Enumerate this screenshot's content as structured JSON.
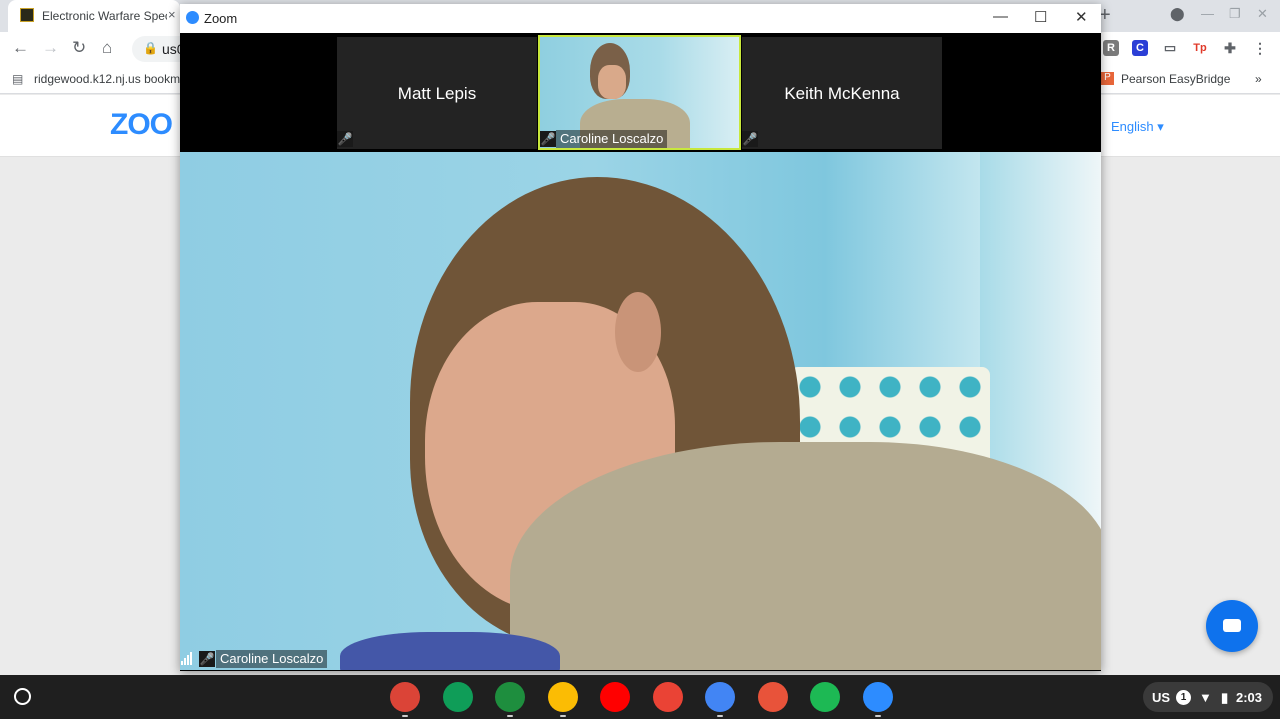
{
  "browser": {
    "tab_title": "Electronic Warfare Spec",
    "tab_close": "×",
    "new_tab": "+",
    "omnibox_text": "us0",
    "bookmark_left": "ridgewood.k12.nj.us bookma",
    "bookmark_right": "Pearson EasyBridge",
    "bookmark_overflow": "»",
    "ext_icons": [
      {
        "label": "R",
        "color": "#7a7a7a"
      },
      {
        "label": "C",
        "color": "#2b3fd6"
      },
      {
        "label": "Tp",
        "color": "#e03a2a"
      }
    ]
  },
  "zoom_site": {
    "logo": "ZOO",
    "language": "English ▾"
  },
  "zoom_window": {
    "title": "Zoom",
    "minimize": "—",
    "maximize": "☐",
    "close": "✕",
    "participants": [
      {
        "name": "Matt Lepis",
        "video": false,
        "muted": true
      },
      {
        "name": "Caroline Loscalzo",
        "video": true,
        "muted": true,
        "active": true
      },
      {
        "name": "Keith McKenna",
        "video": false,
        "muted": true
      }
    ],
    "speaker_name": "Caroline Loscalzo"
  },
  "shelf": {
    "apps": [
      {
        "name": "chrome-icon",
        "color": "#db4437"
      },
      {
        "name": "hangouts-icon",
        "color": "#0f9d58"
      },
      {
        "name": "classroom-icon",
        "color": "#1e8e3e"
      },
      {
        "name": "drive-icon",
        "color": "#fbbc04"
      },
      {
        "name": "youtube-icon",
        "color": "#ff0000"
      },
      {
        "name": "gmail-icon",
        "color": "#ea4335"
      },
      {
        "name": "docs-icon",
        "color": "#4285f4"
      },
      {
        "name": "bookmark-app-icon",
        "color": "#e8533a"
      },
      {
        "name": "spotify-icon",
        "color": "#1db954"
      },
      {
        "name": "zoom-icon",
        "color": "#2d8cff"
      }
    ],
    "keyboard_layout": "US",
    "notification_count": "1",
    "time": "2:03"
  }
}
